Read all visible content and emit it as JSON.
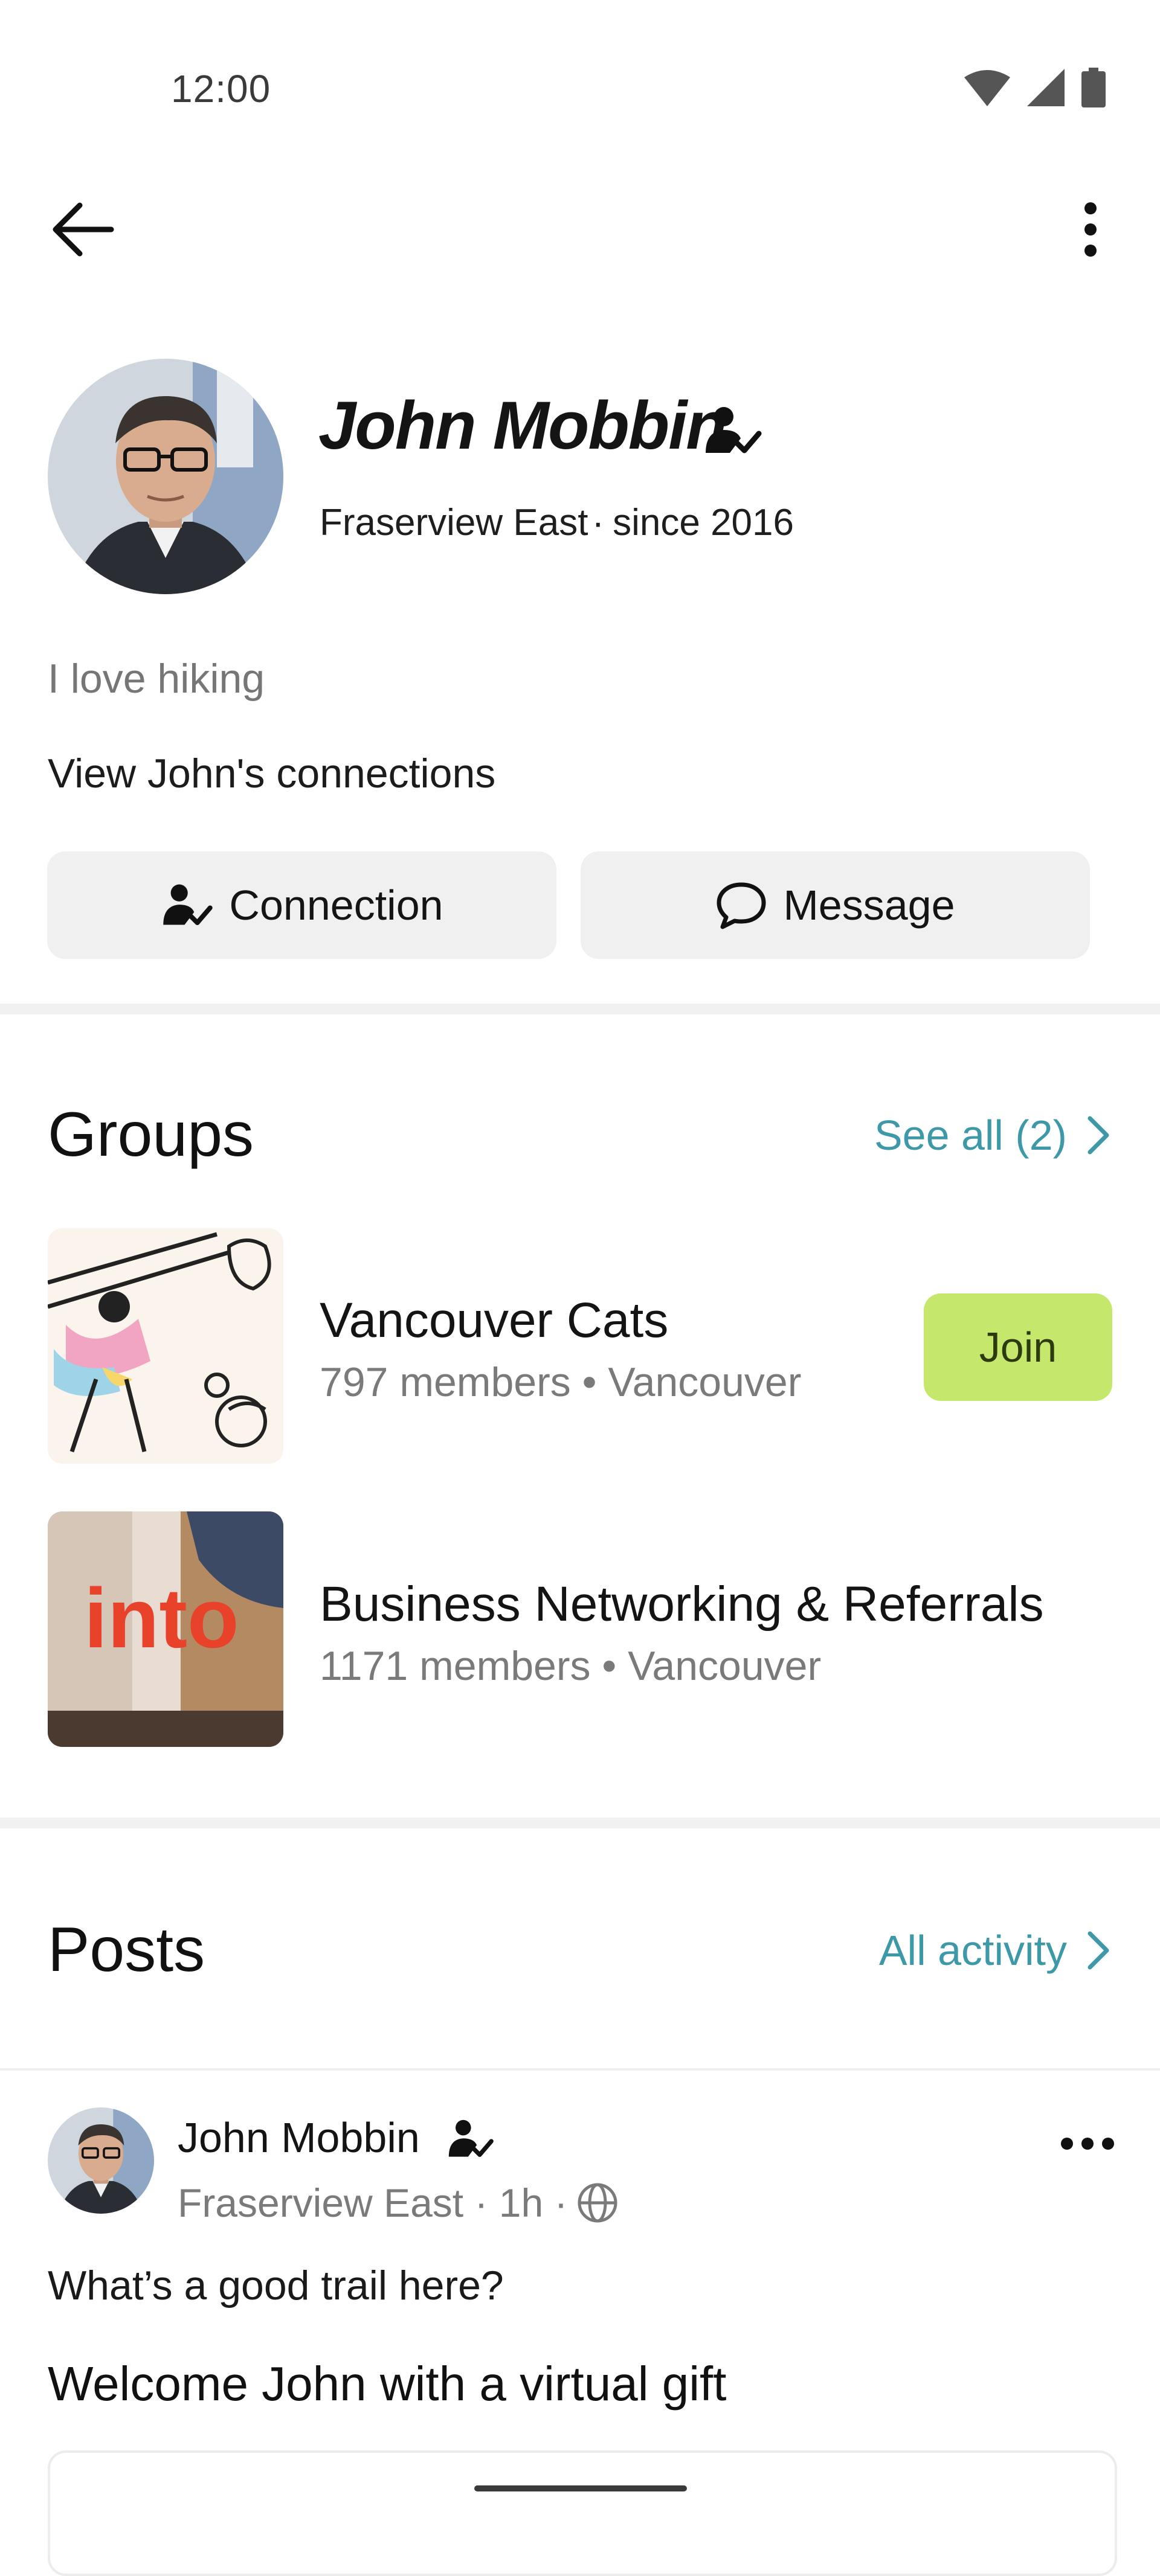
{
  "status_bar": {
    "time": "12:00"
  },
  "profile": {
    "name": "John Mobbin",
    "neighborhood": "Fraserview East",
    "since": "since 2016",
    "bio": "I love hiking",
    "connections_link": "View John's connections",
    "connection_button": "Connection",
    "message_button": "Message"
  },
  "groups": {
    "title": "Groups",
    "see_all": "See all (2)",
    "items": [
      {
        "name": "Vancouver Cats",
        "meta": "797 members • Vancouver",
        "join_label": "Join"
      },
      {
        "name": "Business Networking & Referrals",
        "meta": "1171 members • Vancouver",
        "thumb_text": "into"
      }
    ]
  },
  "posts": {
    "title": "Posts",
    "all_activity": "All activity",
    "post": {
      "author": "John Mobbin",
      "meta": "Fraserview East · 1h ·",
      "text": "What’s a good trail here?",
      "gift_title": "Welcome John with a virtual gift"
    }
  },
  "colors": {
    "link_teal": "#3d98a8",
    "join_green": "#c5e86c",
    "button_gray": "#f0f0f0"
  },
  "icons": [
    "wifi-icon",
    "cellular-signal-icon",
    "battery-icon",
    "back-arrow-icon",
    "more-vertical-icon",
    "verified-neighbor-icon",
    "chat-bubble-icon",
    "chevron-right-icon",
    "globe-icon",
    "more-horizontal-icon"
  ]
}
